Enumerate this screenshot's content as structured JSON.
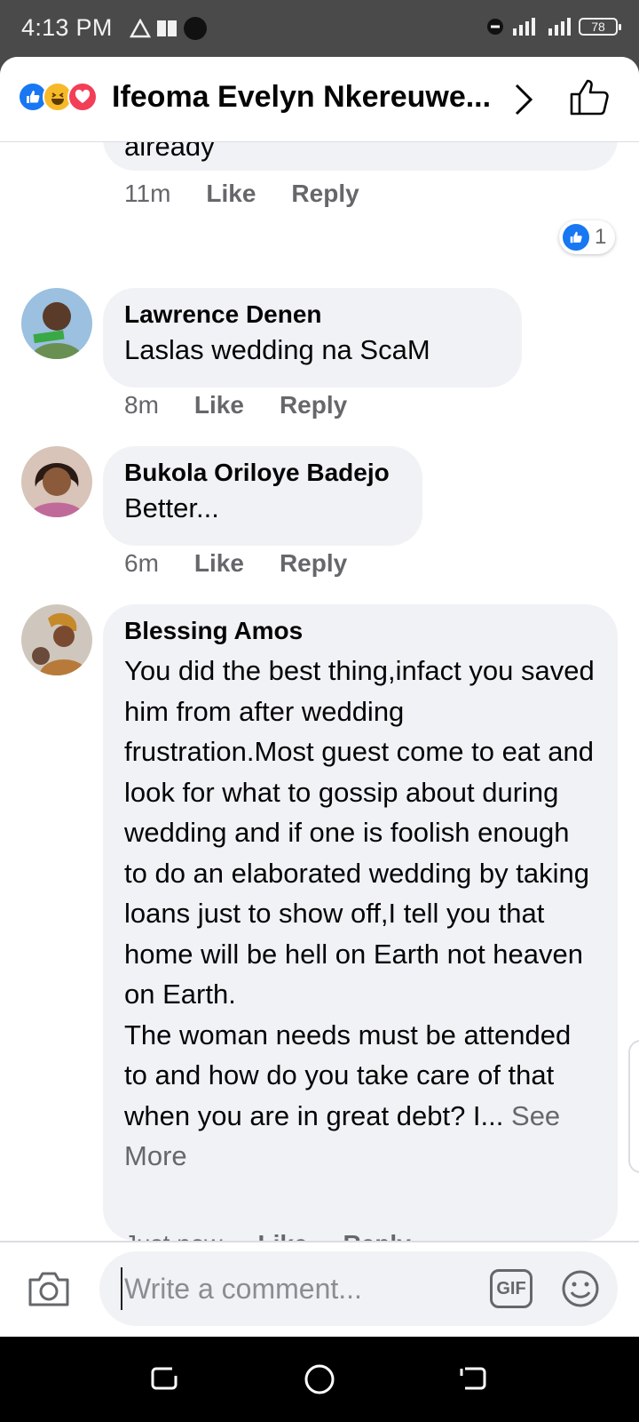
{
  "status_bar": {
    "time": "4:13 PM",
    "battery": "78"
  },
  "header": {
    "title": "Ifeoma Evelyn Nkereuwe..."
  },
  "comments": [
    {
      "text": "already",
      "time": "11m",
      "like_label": "Like",
      "reply_label": "Reply",
      "reaction_count": "1"
    },
    {
      "author": "Lawrence Denen",
      "text": "Laslas wedding na ScaM",
      "time": "8m",
      "like_label": "Like",
      "reply_label": "Reply"
    },
    {
      "author": "Bukola Oriloye Badejo",
      "text": "Better...",
      "time": "6m",
      "like_label": "Like",
      "reply_label": "Reply"
    },
    {
      "author": "Blessing Amos",
      "text": "You did the best thing,infact you saved him from after wedding frustration.Most guest come to eat and look for what to gossip about during  wedding and if one is foolish enough to do an elaborated wedding by taking loans just to show off,I tell you that home will be hell on Earth not heaven on Earth.\nThe woman needs must be attended to and how do you take care of that when you are in great debt? I...",
      "see_more": "See More",
      "time": "Just now",
      "like_label": "Like",
      "reply_label": "Reply"
    }
  ],
  "composer": {
    "placeholder": "Write a comment...",
    "gif_label": "GIF"
  },
  "colors": {
    "accent": "#1877f2",
    "bubble": "#f0f2f5",
    "muted_text": "#65676b"
  },
  "icons": [
    "like-reaction-icon",
    "haha-reaction-icon",
    "love-reaction-icon",
    "chevron-right-icon",
    "thumbs-up-icon",
    "camera-icon",
    "gif-icon",
    "emoji-icon"
  ]
}
